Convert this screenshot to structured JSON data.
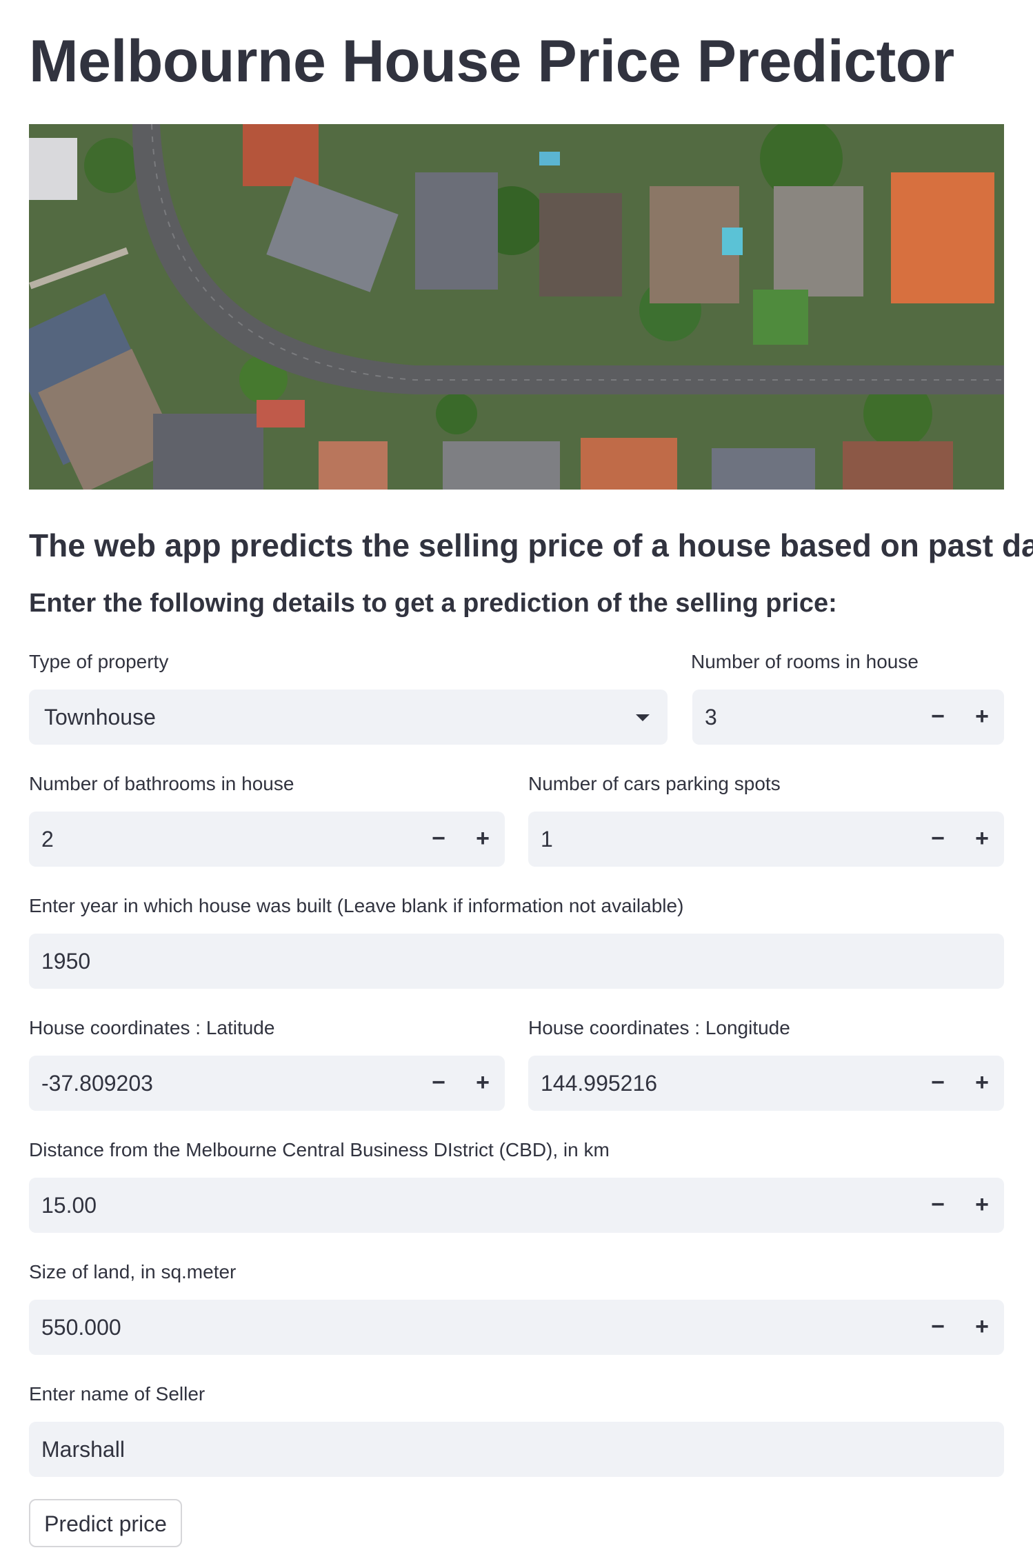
{
  "title": "Melbourne House Price Predictor",
  "subtitle": "The web app predicts the selling price of a house based on past data",
  "instruction": "Enter the following details to get a prediction of the selling price:",
  "fields": {
    "property_type": {
      "label": "Type of property",
      "value": "Townhouse"
    },
    "rooms": {
      "label": "Number of rooms in house",
      "value": "3"
    },
    "bathrooms": {
      "label": "Number of bathrooms in house",
      "value": "2"
    },
    "cars": {
      "label": "Number of cars parking spots",
      "value": "1"
    },
    "year_built": {
      "label": "Enter year in which house was built (Leave blank if information not available)",
      "value": "1950"
    },
    "latitude": {
      "label": "House coordinates : Latitude",
      "value": "-37.809203"
    },
    "longitude": {
      "label": "House coordinates : Longitude",
      "value": "144.995216"
    },
    "distance": {
      "label": "Distance from the Melbourne Central Business DIstrict (CBD), in km",
      "value": "15.00"
    },
    "land_size": {
      "label": "Size of land, in sq.meter",
      "value": "550.000"
    },
    "seller": {
      "label": "Enter name of Seller",
      "value": "Marshall"
    }
  },
  "stepper": {
    "minus": "−",
    "plus": "+"
  },
  "predict_button": "Predict price",
  "icons": {
    "dropdown": "chevron-down-icon"
  },
  "colors": {
    "input_bg": "#f0f2f6",
    "text": "#31333f"
  }
}
